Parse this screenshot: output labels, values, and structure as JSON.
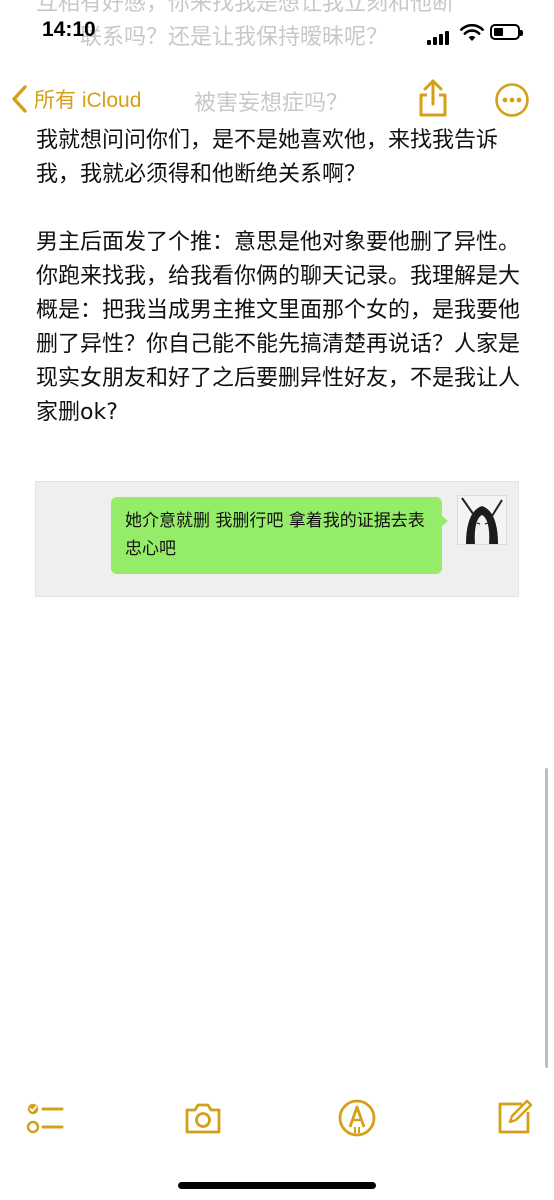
{
  "status_bar": {
    "time": "14:10"
  },
  "background_text": {
    "line1": "互相有好感，你来找我是想让我立刻和他断",
    "line2": "联系吗？还是让我保持暧昧呢？",
    "line3": "被害妄想症吗？"
  },
  "nav": {
    "back_label": "所有 iCloud"
  },
  "note": {
    "paragraphs": [
      "我就想问问你们，是不是她喜欢他，来找我告诉我，我就必须得和他断绝关系啊？",
      "男主后面发了个推：意思是他对象要他删了异性。你跑来找我，给我看你俩的聊天记录。我理解是大概是：把我当成男主推文里面那个女的，是我要他删了异性？你自己能不能先搞清楚再说话？人家是现实女朋友和好了之后要删异性好友，不是我让人家删ok?"
    ]
  },
  "embedded_chat": {
    "message": "她介意就删 我删行吧 拿着我的证据去表忠心吧"
  },
  "colors": {
    "accent": "#d4a017",
    "bubble": "#95ec69"
  },
  "icons": [
    "chevron-left-icon",
    "share-icon",
    "more-icon",
    "checklist-icon",
    "camera-icon",
    "markup-icon",
    "compose-icon"
  ]
}
